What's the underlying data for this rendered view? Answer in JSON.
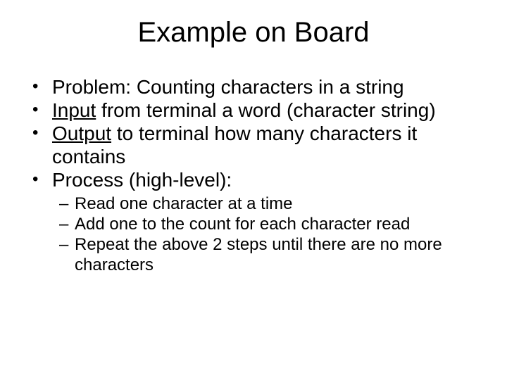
{
  "title": "Example on Board",
  "bullets": {
    "b1": "Problem: Counting characters in a string",
    "b2_underlined": "Input",
    "b2_rest": " from terminal a word (character string)",
    "b3_underlined": "Output",
    "b3_rest": " to terminal how many characters it contains",
    "b4": "Process (high-level):"
  },
  "sub": {
    "s1": "Read one character at a time",
    "s2": "Add one to the count for each character read",
    "s3": "Repeat the above 2 steps until there are no more characters"
  }
}
